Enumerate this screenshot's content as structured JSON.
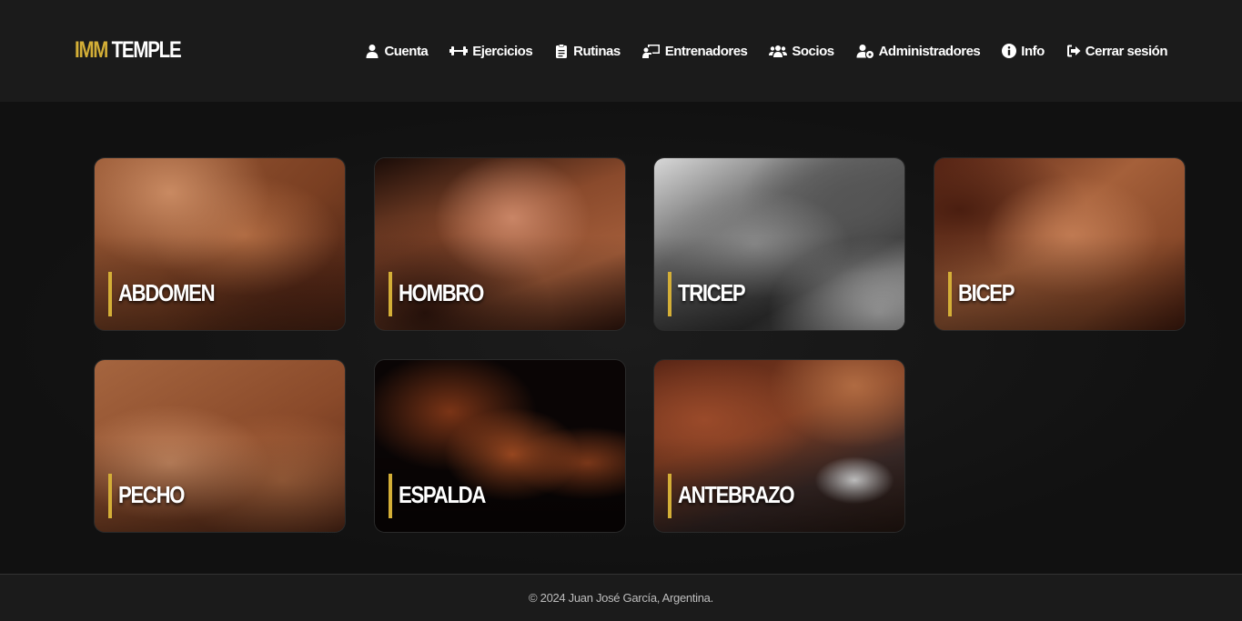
{
  "brand": {
    "part1": "IMM",
    "part2": "TEMPLE"
  },
  "colors": {
    "accent": "#d4af37",
    "header_bg": "#1b1b1b",
    "page_bg": "#121212"
  },
  "nav": [
    {
      "label": "Cuenta",
      "icon": "user-icon"
    },
    {
      "label": "Ejercicios",
      "icon": "dumbbell-icon"
    },
    {
      "label": "Rutinas",
      "icon": "clipboard-icon"
    },
    {
      "label": "Entrenadores",
      "icon": "chalkboard-teacher-icon"
    },
    {
      "label": "Socios",
      "icon": "users-icon"
    },
    {
      "label": "Administradores",
      "icon": "user-gear-icon"
    },
    {
      "label": "Info",
      "icon": "info-circle-icon"
    },
    {
      "label": "Cerrar sesión",
      "icon": "sign-out-icon"
    }
  ],
  "cards": [
    {
      "label": "ABDOMEN"
    },
    {
      "label": "HOMBRO"
    },
    {
      "label": "TRICEP"
    },
    {
      "label": "BICEP"
    },
    {
      "label": "PECHO"
    },
    {
      "label": "ESPALDA"
    },
    {
      "label": "ANTEBRAZO"
    }
  ],
  "footer": {
    "text": "© 2024 Juan José García, Argentina."
  }
}
